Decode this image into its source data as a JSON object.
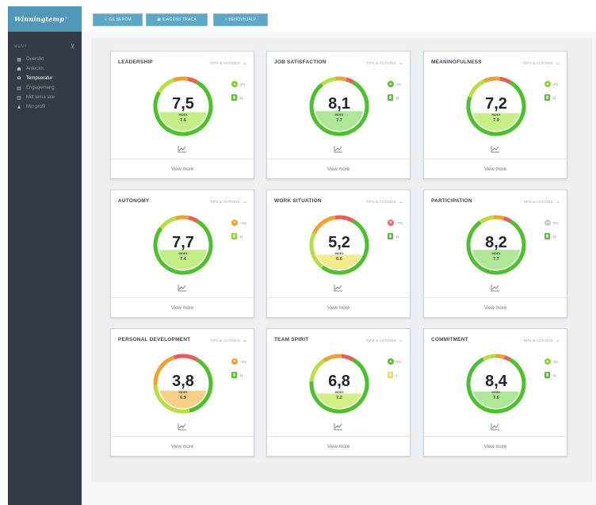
{
  "app": {
    "logo": "Winningtemp",
    "logo_mark": "°"
  },
  "sidebar": {
    "section_label": "MENY",
    "items": [
      {
        "label": "Översikt",
        "icon": "grid-icon",
        "glyph": "▦",
        "active": false
      },
      {
        "label": "Anteckn.",
        "icon": "chat-icon",
        "glyph": "☗",
        "active": false
      },
      {
        "label": "Tempseratur",
        "icon": "gauge-icon",
        "glyph": "◘",
        "active": true
      },
      {
        "label": "Engagemang",
        "icon": "document-icon",
        "glyph": "▤",
        "active": false
      },
      {
        "label": "Mitt tema tale",
        "icon": "clipboard-icon",
        "glyph": "▥",
        "active": false
      },
      {
        "label": "Min profil",
        "icon": "user-icon",
        "glyph": "♟",
        "active": false
      }
    ]
  },
  "toolbar": {
    "buttons": [
      {
        "label": "☉ GE BERÖM",
        "icon": "smile-icon"
      },
      {
        "label": "▣ IDAGENS TRACA",
        "icon": "calendar-icon"
      },
      {
        "label": "○ BEHÖVHJÄLP",
        "icon": "help-icon"
      }
    ]
  },
  "cards": [
    {
      "title": "LEADERSHIP",
      "tips": "TIPS & ACTIONS",
      "value": "7,5",
      "index_label": "INDEX",
      "index": "7.6",
      "score": 7.5,
      "fill": 0.38,
      "fill_color": "#c3ee86",
      "change": "2%",
      "change_color": "#7fce2c",
      "change_glyph": "▲",
      "count": "11",
      "count_color": "#55c32d",
      "view_more": "View more"
    },
    {
      "title": "JOB SATISFACTION",
      "tips": "TIPS & ACTIONS",
      "value": "8,1",
      "index_label": "INDEX",
      "index": "7.7",
      "score": 8.1,
      "fill": 0.4,
      "fill_color": "#aee896",
      "change": "1%",
      "change_color": "#55c32d",
      "change_glyph": "▲",
      "count": "11",
      "count_color": "#55c32d",
      "view_more": "View more"
    },
    {
      "title": "MEANINGFULNESS",
      "tips": "TIPS & ACTIONS",
      "value": "7,2",
      "index_label": "INDEX",
      "index": "7.9",
      "score": 7.2,
      "fill": 0.36,
      "fill_color": "#c6ef86",
      "change": "2%",
      "change_color": "#8fd32c",
      "change_glyph": "▲",
      "count": "11",
      "count_color": "#55c32d",
      "view_more": "View more"
    },
    {
      "title": "AUTONOMY",
      "tips": "TIPS & ACTIONS",
      "value": "7,7",
      "index_label": "INDEX",
      "index": "7.4",
      "score": 7.7,
      "fill": 0.4,
      "fill_color": "#c3ee86",
      "change": "-4%",
      "change_color": "#f0a12a",
      "change_glyph": "▼",
      "count": "11",
      "count_color": "#8fd32c",
      "view_more": "View more"
    },
    {
      "title": "WORK SITUATION",
      "tips": "TIPS & ACTIONS",
      "value": "5,2",
      "index_label": "INDEX",
      "index": "6.6",
      "score": 5.2,
      "fill": 0.3,
      "fill_color": "#f3ea8a",
      "change": "-7%",
      "change_color": "#ee6a63",
      "change_glyph": "▼",
      "count": "11",
      "count_color": "#55c32d",
      "view_more": "View more"
    },
    {
      "title": "PARTICIPATION",
      "tips": "TIPS & ACTIONS",
      "value": "8,2",
      "index_label": "INDEX",
      "index": "7.7",
      "score": 8.2,
      "fill": 0.4,
      "fill_color": "#aee896",
      "change": "0%",
      "change_color": "#c7ccd1",
      "change_glyph": "—",
      "count": "11",
      "count_color": "#55c32d",
      "view_more": "View more"
    },
    {
      "title": "PERSONAL DEVELOPMENT",
      "tips": "TIPS & ACTIONS",
      "value": "3,8",
      "index_label": "INDEX",
      "index": "6.9",
      "score": 3.8,
      "fill": 0.36,
      "fill_color": "#f8cf86",
      "change": "-3%",
      "change_color": "#f0a12a",
      "change_glyph": "▼",
      "count": "11",
      "count_color": "#55c32d",
      "view_more": "View more"
    },
    {
      "title": "TEAM SPIRIT",
      "tips": "TIPS & ACTIONS",
      "value": "6,8",
      "index_label": "INDEX",
      "index": "7.2",
      "score": 6.8,
      "fill": 0.3,
      "fill_color": "#d3ef86",
      "change": "5%",
      "change_color": "#55c32d",
      "change_glyph": "▲",
      "count": "1",
      "count_color": "#f3d84a",
      "view_more": "View more"
    },
    {
      "title": "COMMITMENT",
      "tips": "TIPS & ACTIONS",
      "value": "8,4",
      "index_label": "INDEX",
      "index": "7.6",
      "score": 8.4,
      "fill": 0.34,
      "fill_color": "#aee896",
      "change": "3%",
      "change_color": "#8fd32c",
      "change_glyph": "▲",
      "count": "11",
      "count_color": "#55c32d",
      "view_more": "View more"
    }
  ],
  "colors": {
    "sidebar": "#343d46",
    "brand": "#4f98b8",
    "button": "#5ba8c8",
    "gauge_green": "#4cc22a",
    "gauge_lime": "#b7e03a",
    "gauge_orange": "#f0a12a",
    "gauge_red": "#ee5a55"
  }
}
